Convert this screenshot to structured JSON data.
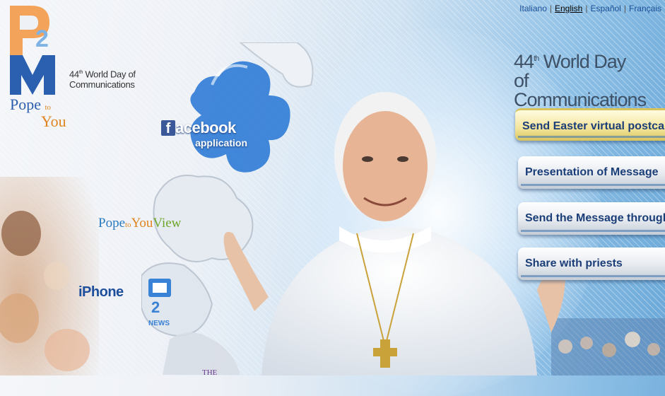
{
  "languages": {
    "items": [
      {
        "label": "Italiano",
        "active": false
      },
      {
        "label": "English",
        "active": true
      },
      {
        "label": "Español",
        "active": false
      },
      {
        "label": "Français",
        "active": false
      }
    ],
    "separator": "|"
  },
  "logo": {
    "tagline_number": "44",
    "tagline_suffix": "th",
    "tagline_line1": "World Day of",
    "tagline_line2": "Communications",
    "pope": "Pope",
    "to": "to",
    "you": "You"
  },
  "heading": {
    "number": "44",
    "suffix": "th",
    "line1": "World Day",
    "line2": "of Communications"
  },
  "facebook": {
    "icon_letter": "f",
    "brand": "acebook",
    "subtitle": "application"
  },
  "pope_to_you_view": {
    "pope": "Pope",
    "to": "to",
    "you": "You",
    "view": "View"
  },
  "iphone": {
    "label": "iPhone"
  },
  "news_icon": {
    "label": "NEWS"
  },
  "the_text": "THE",
  "menu": [
    {
      "label": "Send Easter virtual postcard",
      "highlighted": true
    },
    {
      "label": "Presentation of Message",
      "highlighted": false
    },
    {
      "label": "Send the Message through Fa",
      "highlighted": false
    },
    {
      "label": "Share with priests",
      "highlighted": false
    }
  ],
  "colors": {
    "accent_blue": "#1b3e78",
    "link_blue": "#1b4f96",
    "orange": "#e08420",
    "facebook_blue": "#3b5998",
    "highlight_gold": "#f3e49a"
  }
}
